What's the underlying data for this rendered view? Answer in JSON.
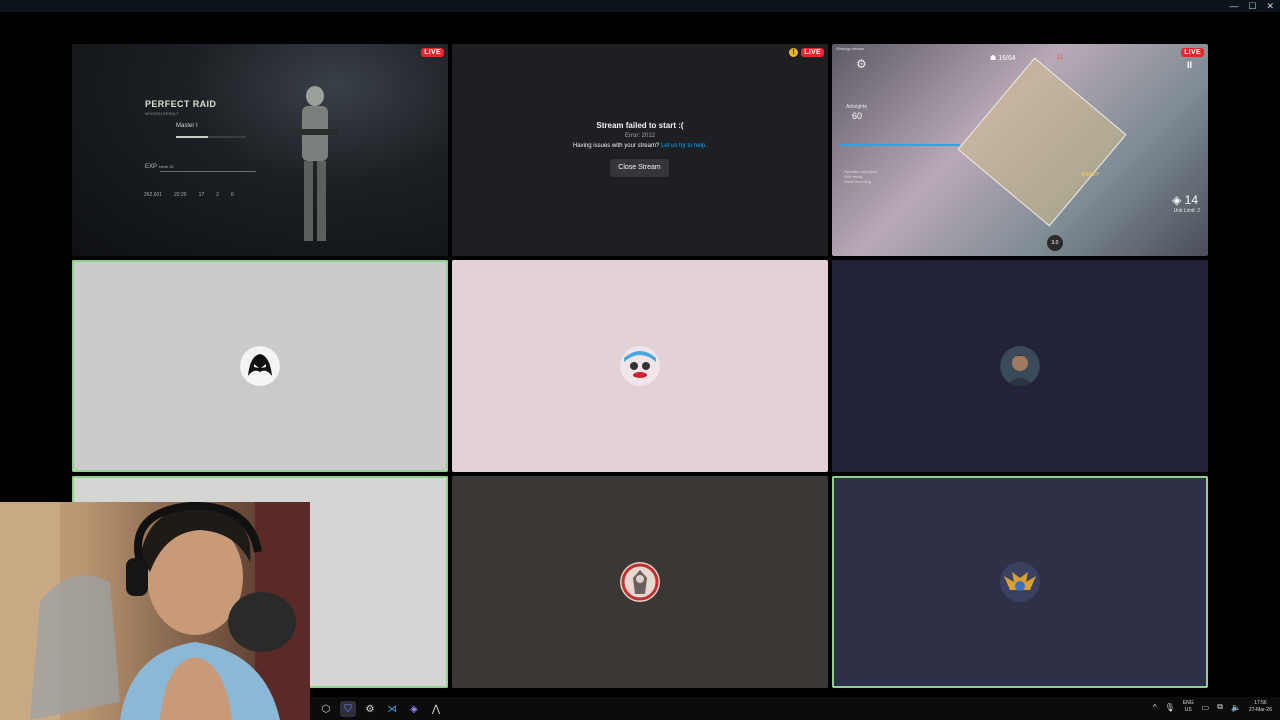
{
  "window": {
    "minimize": "—",
    "maximize": "☐",
    "close": "✕"
  },
  "tiles": {
    "game1": {
      "live": "LIVE",
      "title": "PERFECT RAID",
      "subtitle": "MISSION RESULT",
      "rank": "Master I",
      "exp_label": "EXP",
      "level": "Level 32",
      "stats": [
        "262,601",
        "22:29",
        "17",
        "2",
        "6"
      ]
    },
    "failed": {
      "live": "LIVE",
      "warning": "!",
      "title": "Stream failed to start :(",
      "error": "Error: 2012",
      "help_text": "Having issues with your stream?",
      "help_link": "Let us try to help.",
      "close_button": "Close Stream"
    },
    "game2": {
      "live": "LIVE",
      "header": "Strategy stream",
      "enemy_count": "16/64",
      "life": "11",
      "level": "60",
      "operator": "Arknights",
      "dp": "14",
      "unit_limit": "Unit Limit: 2",
      "pause": "II",
      "chat": [
        "Operator deployed",
        "Skill ready",
        "Wave incoming"
      ],
      "skill_ready": "READY",
      "skill_cd": "3.0",
      "settings_icon": "gear-icon"
    }
  },
  "participants": [
    {
      "id": "t4",
      "avatar_icon": "venom-avatar",
      "speaking": true
    },
    {
      "id": "t5",
      "avatar_icon": "clown-avatar",
      "speaking": false
    },
    {
      "id": "t6",
      "avatar_icon": "person-avatar",
      "speaking": false
    },
    {
      "id": "t7",
      "avatar_icon": "blank-avatar",
      "speaking": true
    },
    {
      "id": "t8",
      "avatar_icon": "warrior-avatar",
      "speaking": false
    },
    {
      "id": "t9",
      "avatar_icon": "dragon-avatar",
      "speaking": true
    }
  ],
  "taskbar": {
    "apps": [
      "obs-icon",
      "bitwarden-icon",
      "settings-icon",
      "vscode-icon",
      "app-icon",
      "arrow-icon"
    ],
    "tray": {
      "lang_top": "ENG",
      "lang_bottom": "US",
      "time": "17:56",
      "date": "27-Mar-26"
    }
  },
  "colors": {
    "live": "#e22a2a",
    "speaking": "#8fd08f",
    "link": "#00a8fc"
  }
}
